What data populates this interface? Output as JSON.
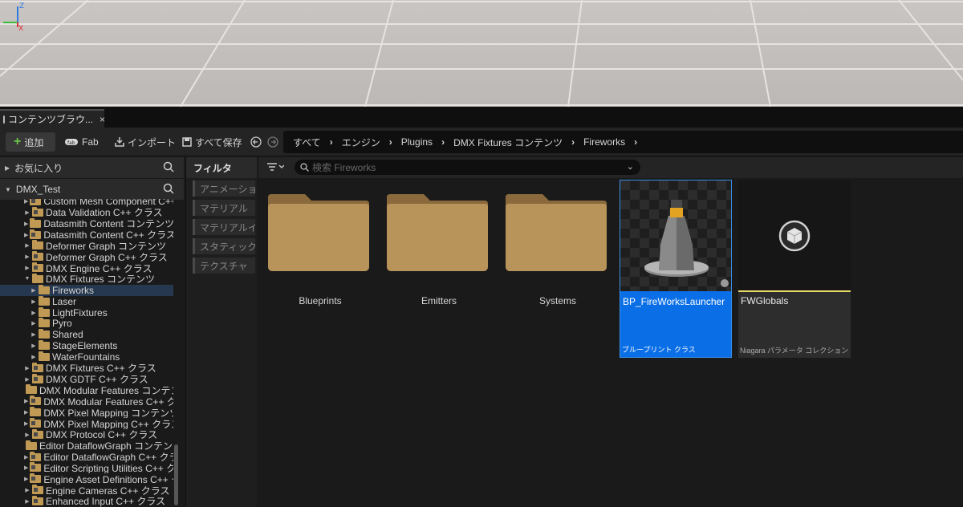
{
  "tab": {
    "title": "コンテンツブラウ...",
    "close_label": "×"
  },
  "toolbar": {
    "add_label": "追加",
    "fab_label": "Fab",
    "import_label": "インポート",
    "save_all_label": "すべて保存",
    "breadcrumb": [
      "すべて",
      "エンジン",
      "Plugins",
      "DMX Fixtures コンテンツ",
      "Fireworks"
    ]
  },
  "left_panel": {
    "favorites_label": "お気に入り",
    "root_label": "DMX_Test",
    "tree": [
      {
        "label": "Custom Mesh Component C++",
        "indent": 0,
        "cpp": true,
        "expand": "▶"
      },
      {
        "label": "Data Validation C++ クラス",
        "indent": 0,
        "cpp": true,
        "expand": "▶"
      },
      {
        "label": "Datasmith Content コンテンツ",
        "indent": 0,
        "cpp": false,
        "expand": "▶"
      },
      {
        "label": "Datasmith Content C++ クラス",
        "indent": 0,
        "cpp": true,
        "expand": "▶"
      },
      {
        "label": "Deformer Graph コンテンツ",
        "indent": 0,
        "cpp": false,
        "expand": "▶"
      },
      {
        "label": "Deformer Graph C++ クラス",
        "indent": 0,
        "cpp": true,
        "expand": "▶"
      },
      {
        "label": "DMX Engine C++ クラス",
        "indent": 0,
        "cpp": true,
        "expand": "▶"
      },
      {
        "label": "DMX Fixtures コンテンツ",
        "indent": 0,
        "cpp": false,
        "expand": "▼"
      },
      {
        "label": "Fireworks",
        "indent": 1,
        "cpp": false,
        "expand": "▶",
        "selected": true
      },
      {
        "label": "Laser",
        "indent": 1,
        "cpp": false,
        "expand": "▶"
      },
      {
        "label": "LightFixtures",
        "indent": 1,
        "cpp": false,
        "expand": "▶"
      },
      {
        "label": "Pyro",
        "indent": 1,
        "cpp": false,
        "expand": "▶"
      },
      {
        "label": "Shared",
        "indent": 1,
        "cpp": false,
        "expand": "▶"
      },
      {
        "label": "StageElements",
        "indent": 1,
        "cpp": false,
        "expand": "▶"
      },
      {
        "label": "WaterFountains",
        "indent": 1,
        "cpp": false,
        "expand": "▶"
      },
      {
        "label": "DMX Fixtures C++ クラス",
        "indent": 0,
        "cpp": true,
        "expand": "▶"
      },
      {
        "label": "DMX GDTF C++ クラス",
        "indent": 0,
        "cpp": true,
        "expand": "▶"
      },
      {
        "label": "DMX Modular Features コンテンツ",
        "indent": 0,
        "cpp": false,
        "expand": ""
      },
      {
        "label": "DMX Modular Features C++ クラス",
        "indent": 0,
        "cpp": true,
        "expand": "▶"
      },
      {
        "label": "DMX Pixel Mapping コンテンツ",
        "indent": 0,
        "cpp": false,
        "expand": "▶"
      },
      {
        "label": "DMX Pixel Mapping C++ クラス",
        "indent": 0,
        "cpp": true,
        "expand": "▶"
      },
      {
        "label": "DMX Protocol C++ クラス",
        "indent": 0,
        "cpp": true,
        "expand": "▶"
      },
      {
        "label": "Editor DataflowGraph コンテンツ",
        "indent": 0,
        "cpp": false,
        "expand": ""
      },
      {
        "label": "Editor DataflowGraph C++ クラス",
        "indent": 0,
        "cpp": true,
        "expand": "▶"
      },
      {
        "label": "Editor Scripting Utilities C++ クラス",
        "indent": 0,
        "cpp": true,
        "expand": "▶"
      },
      {
        "label": "Engine Asset Definitions C++ クラス",
        "indent": 0,
        "cpp": true,
        "expand": "▶"
      },
      {
        "label": "Engine Cameras C++ クラス",
        "indent": 0,
        "cpp": true,
        "expand": "▶"
      },
      {
        "label": "Enhanced Input C++ クラス",
        "indent": 0,
        "cpp": true,
        "expand": "▶"
      }
    ]
  },
  "filters": {
    "title": "フィルタ",
    "chips": [
      "アニメーション",
      "マテリアル",
      "マテリアルインスタンス",
      "スタティックメッシュ",
      "テクスチャ"
    ]
  },
  "search": {
    "placeholder": "検索 Fireworks"
  },
  "assets": {
    "folders": [
      "Blueprints",
      "Emitters",
      "Systems"
    ],
    "blueprint": {
      "name": "BP_FireWorksLauncher",
      "type": "ブループリント クラス"
    },
    "params": {
      "name": "FWGlobals",
      "type": "Niagara パラメータ コレクション"
    }
  },
  "colors": {
    "accent": "#0a6fe6",
    "folder": "#c09a55",
    "selected_row": "#26384f",
    "add_icon": "#6cc64a"
  }
}
